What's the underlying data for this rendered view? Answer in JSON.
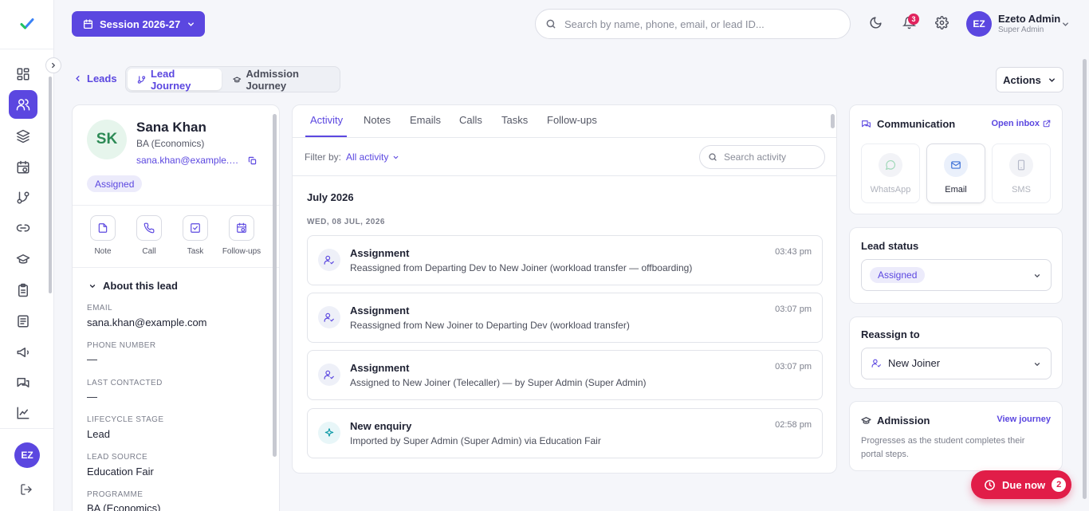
{
  "topbar": {
    "session_label": "Session 2026-27",
    "search_placeholder": "Search by name, phone, email, or lead ID...",
    "notification_count": "3",
    "user_initials": "EZ",
    "user_name": "Ezeto Admin",
    "user_role": "Super Admin"
  },
  "sidebar": {
    "items": [
      {
        "icon": "dashboard-icon"
      },
      {
        "icon": "users-icon",
        "active": true
      },
      {
        "icon": "layers-icon"
      },
      {
        "icon": "calendar-clock-icon"
      },
      {
        "icon": "git-branch-icon"
      },
      {
        "icon": "link-icon"
      },
      {
        "icon": "graduation-cap-icon"
      },
      {
        "icon": "clipboard-icon"
      },
      {
        "icon": "document-icon"
      },
      {
        "icon": "megaphone-icon"
      },
      {
        "icon": "chat-icon"
      },
      {
        "icon": "chart-icon"
      }
    ],
    "avatar_initials": "EZ"
  },
  "header": {
    "back_label": "Leads",
    "tab_lead_journey": "Lead Journey",
    "tab_admission_journey": "Admission Journey",
    "actions_label": "Actions"
  },
  "lead": {
    "initials": "SK",
    "name": "Sana Khan",
    "programme": "BA (Economics)",
    "email_short": "sana.khan@example.c...",
    "status_badge": "Assigned",
    "quick_actions": [
      "Note",
      "Call",
      "Task",
      "Follow-ups"
    ],
    "about_title": "About this lead",
    "fields": [
      {
        "label": "Email",
        "value": "sana.khan@example.com"
      },
      {
        "label": "Phone number",
        "value": "—"
      },
      {
        "label": "Last contacted",
        "value": "—"
      },
      {
        "label": "Lifecycle stage",
        "value": "Lead"
      },
      {
        "label": "Lead source",
        "value": "Education Fair"
      },
      {
        "label": "Programme",
        "value": "BA (Economics)"
      }
    ]
  },
  "activity": {
    "tabs": [
      "Activity",
      "Notes",
      "Emails",
      "Calls",
      "Tasks",
      "Follow-ups"
    ],
    "filter_label": "Filter by:",
    "filter_value": "All activity",
    "search_placeholder": "Search activity",
    "month": "July 2026",
    "day": "WED, 08 JUL, 2026",
    "items": [
      {
        "title": "Assignment",
        "desc": "Reassigned from Departing Dev to New Joiner (workload transfer — offboarding)",
        "time": "03:43 pm",
        "icon": "user-check-icon"
      },
      {
        "title": "Assignment",
        "desc": "Reassigned from New Joiner to Departing Dev (workload transfer)",
        "time": "03:07 pm",
        "icon": "user-check-icon"
      },
      {
        "title": "Assignment",
        "desc": "Assigned to New Joiner (Telecaller) — by Super Admin (Super Admin)",
        "time": "03:07 pm",
        "icon": "user-check-icon"
      },
      {
        "title": "New enquiry",
        "desc": "Imported by Super Admin (Super Admin) via Education Fair",
        "time": "02:58 pm",
        "icon": "sparkle-icon"
      }
    ]
  },
  "communication": {
    "title": "Communication",
    "open_inbox": "Open inbox",
    "channels": [
      "WhatsApp",
      "Email",
      "SMS"
    ]
  },
  "lead_status": {
    "title": "Lead status",
    "value": "Assigned"
  },
  "reassign": {
    "title": "Reassign to",
    "value": "New Joiner"
  },
  "admission": {
    "title": "Admission",
    "link": "View journey",
    "desc": "Progresses as the student completes their portal steps."
  },
  "due_now": {
    "label": "Due now",
    "count": "2"
  },
  "colors": {
    "accent": "#5b47e0",
    "danger": "#e11d48",
    "success": "#2c8a55"
  }
}
